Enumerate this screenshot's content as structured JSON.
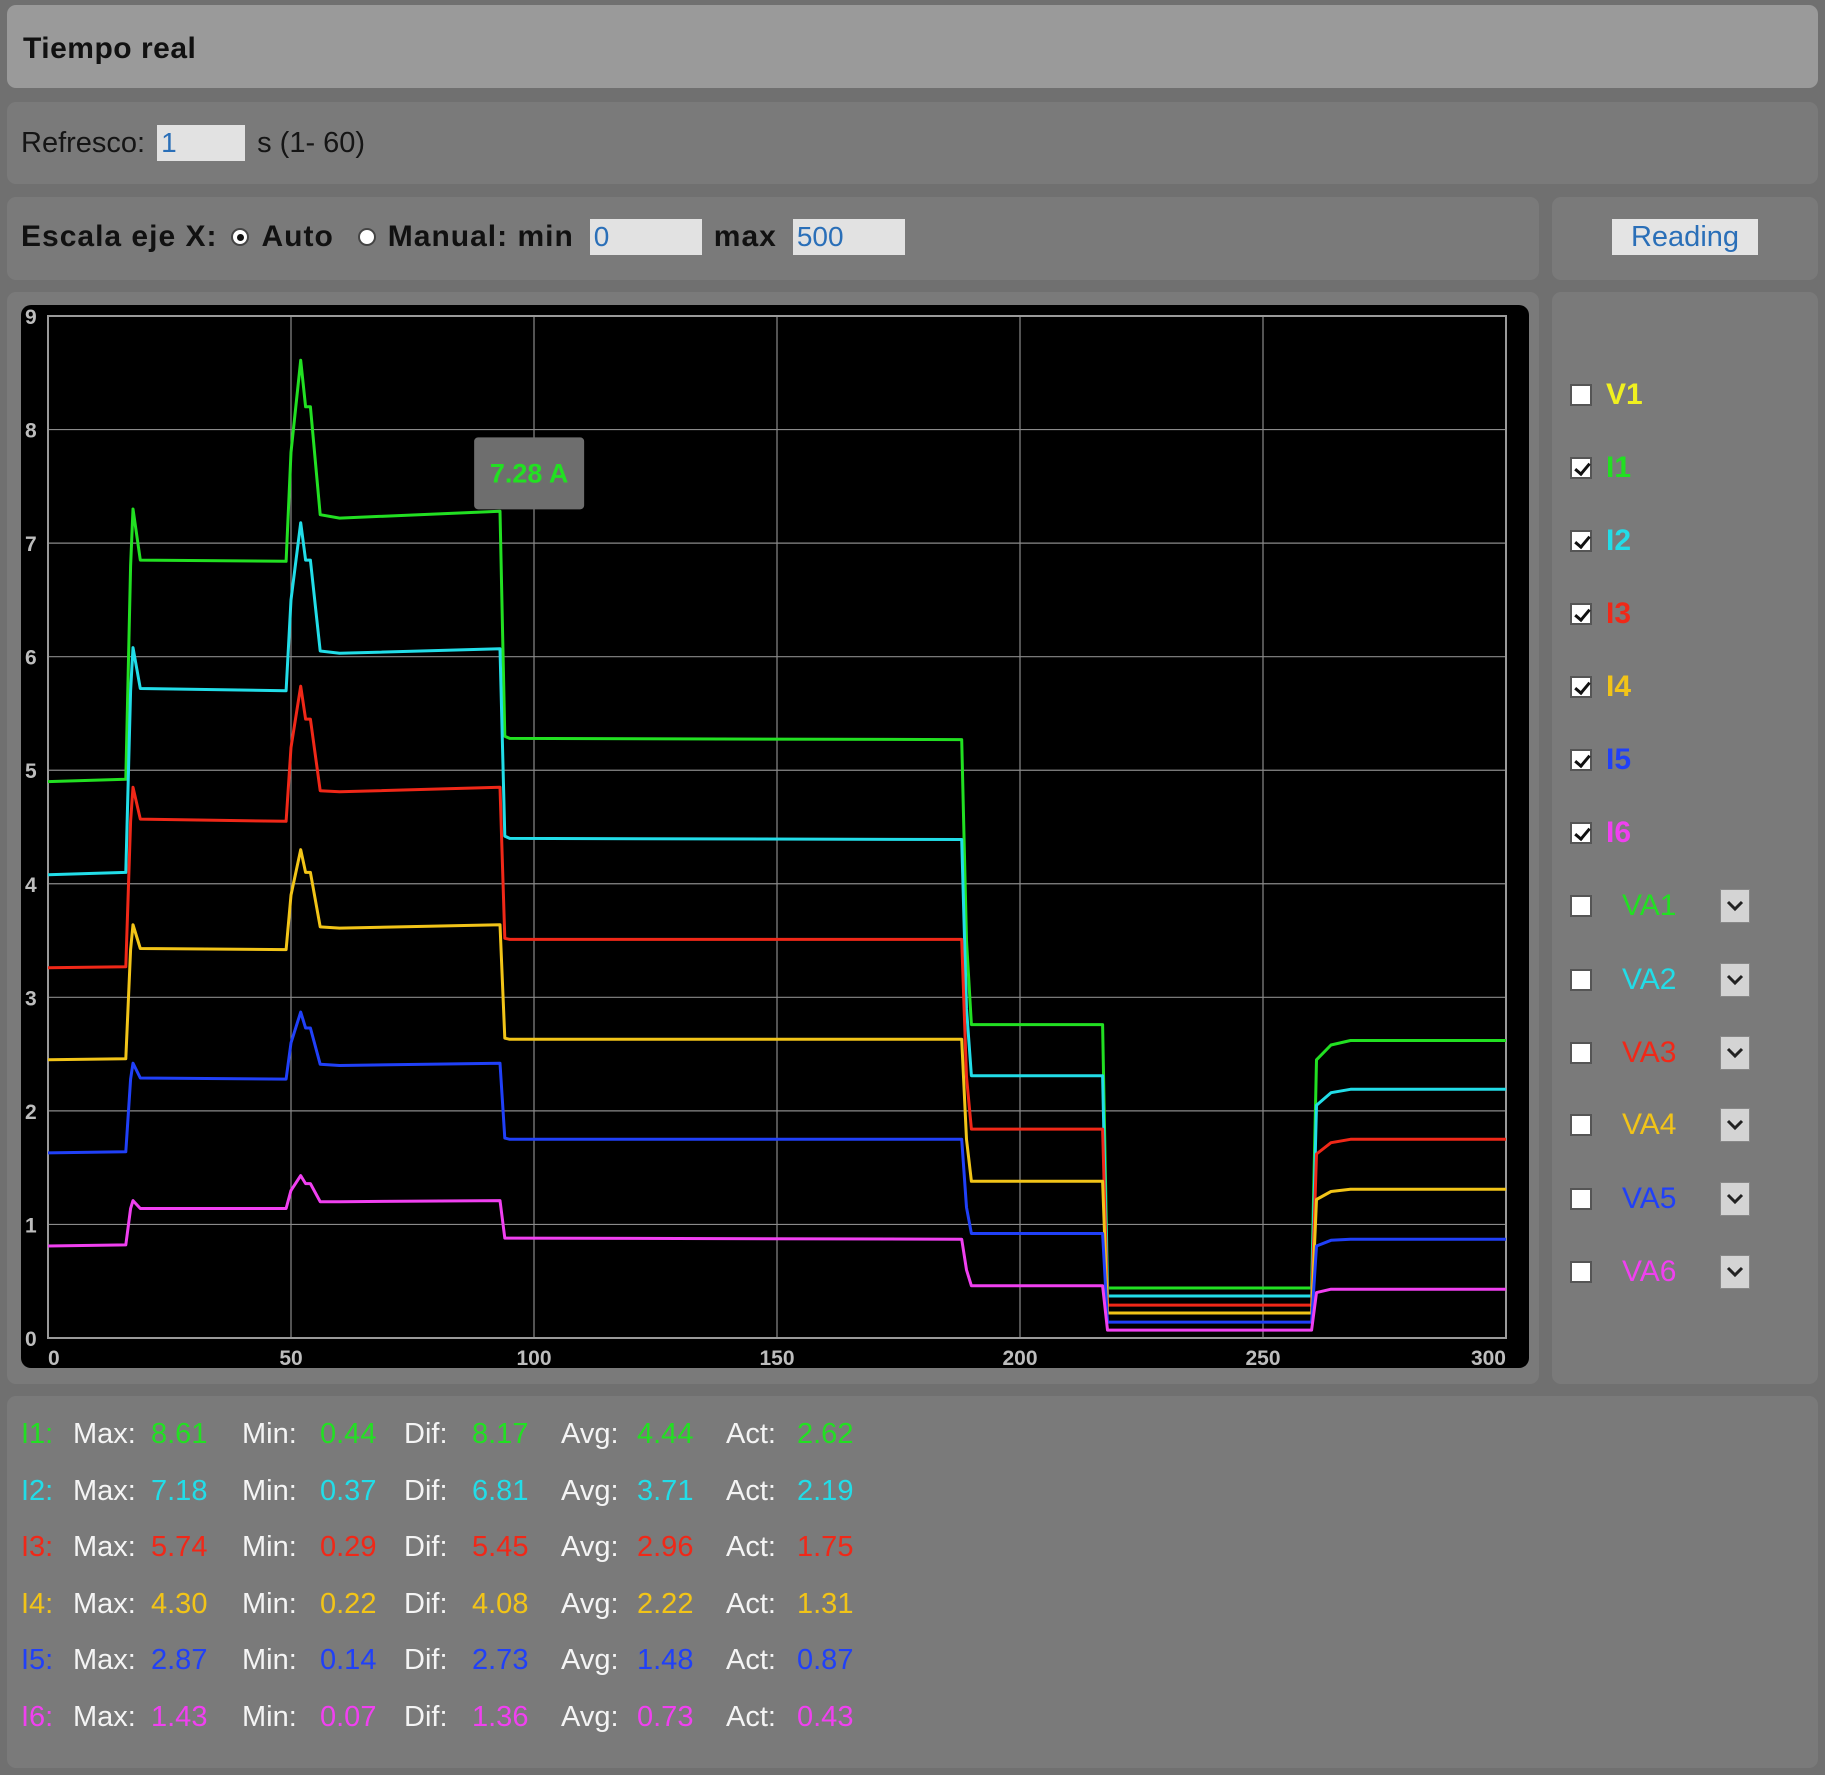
{
  "title": "Tiempo real",
  "refresh": {
    "label": "Refresco:",
    "value": "1",
    "suffix": "s (1- 60)"
  },
  "xscale": {
    "label": "Escala eje X:",
    "auto_label": "Auto",
    "manual_label": "Manual: min",
    "min_value": "0",
    "max_label": "max",
    "max_value": "500",
    "selected": "Auto"
  },
  "reading_button": "Reading",
  "colors": {
    "I1": "#22e022",
    "I2": "#22dde8",
    "I3": "#f02818",
    "I4": "#f2c418",
    "I5": "#2040f8",
    "I6": "#f040f0",
    "V1": "#f0f020",
    "background": "#707070",
    "plot_bg": "#000000"
  },
  "legend": [
    {
      "label": "V1",
      "checked": false,
      "color": "#f0f020",
      "dropdown": false
    },
    {
      "label": "I1",
      "checked": true,
      "color": "#22e022",
      "dropdown": false
    },
    {
      "label": "I2",
      "checked": true,
      "color": "#22dde8",
      "dropdown": false
    },
    {
      "label": "I3",
      "checked": true,
      "color": "#f02818",
      "dropdown": false
    },
    {
      "label": "I4",
      "checked": true,
      "color": "#f2c418",
      "dropdown": false
    },
    {
      "label": "I5",
      "checked": true,
      "color": "#2040f8",
      "dropdown": false
    },
    {
      "label": "I6",
      "checked": true,
      "color": "#f040f0",
      "dropdown": false
    },
    {
      "label": "VA1",
      "checked": false,
      "color": "#22e022",
      "dropdown": true
    },
    {
      "label": "VA2",
      "checked": false,
      "color": "#22dde8",
      "dropdown": true
    },
    {
      "label": "VA3",
      "checked": false,
      "color": "#f02818",
      "dropdown": true
    },
    {
      "label": "VA4",
      "checked": false,
      "color": "#f2c418",
      "dropdown": true
    },
    {
      "label": "VA5",
      "checked": false,
      "color": "#2040f8",
      "dropdown": true
    },
    {
      "label": "VA6",
      "checked": false,
      "color": "#f040f0",
      "dropdown": true
    }
  ],
  "tooltip": {
    "text": "7.28 A",
    "x": 99,
    "y": 7.28
  },
  "stats_labels": {
    "max": "Max:",
    "min": "Min:",
    "dif": "Dif:",
    "avg": "Avg:",
    "act": "Act:"
  },
  "stats": [
    {
      "name": "I1:",
      "color": "#22e022",
      "max": "8.61",
      "min": "0.44",
      "dif": "8.17",
      "avg": "4.44",
      "act": "2.62"
    },
    {
      "name": "I2:",
      "color": "#22dde8",
      "max": "7.18",
      "min": "0.37",
      "dif": "6.81",
      "avg": "3.71",
      "act": "2.19"
    },
    {
      "name": "I3:",
      "color": "#f02818",
      "max": "5.74",
      "min": "0.29",
      "dif": "5.45",
      "avg": "2.96",
      "act": "1.75"
    },
    {
      "name": "I4:",
      "color": "#f2c418",
      "max": "4.30",
      "min": "0.22",
      "dif": "4.08",
      "avg": "2.22",
      "act": "1.31"
    },
    {
      "name": "I5:",
      "color": "#2040f8",
      "max": "2.87",
      "min": "0.14",
      "dif": "2.73",
      "avg": "1.48",
      "act": "0.87"
    },
    {
      "name": "I6:",
      "color": "#f040f0",
      "max": "1.43",
      "min": "0.07",
      "dif": "1.36",
      "avg": "0.73",
      "act": "0.43"
    }
  ],
  "chart_data": {
    "type": "line",
    "xlim": [
      0,
      300
    ],
    "ylim": [
      0,
      9
    ],
    "xticks": [
      0,
      50,
      100,
      150,
      200,
      250,
      300
    ],
    "yticks": [
      0,
      1,
      2,
      3,
      4,
      5,
      6,
      7,
      8,
      9
    ],
    "grid": true,
    "series": [
      {
        "name": "I1",
        "color": "#22e022",
        "points": [
          [
            0,
            4.9
          ],
          [
            16,
            4.92
          ],
          [
            17,
            6.8
          ],
          [
            17.5,
            7.3
          ],
          [
            19,
            6.85
          ],
          [
            49,
            6.84
          ],
          [
            50,
            7.8
          ],
          [
            52,
            8.61
          ],
          [
            53,
            8.2
          ],
          [
            54,
            8.2
          ],
          [
            56,
            7.25
          ],
          [
            60,
            7.22
          ],
          [
            93,
            7.28
          ],
          [
            94,
            5.3
          ],
          [
            95,
            5.28
          ],
          [
            188,
            5.27
          ],
          [
            189,
            3.5
          ],
          [
            190,
            2.76
          ],
          [
            217,
            2.76
          ],
          [
            218,
            0.44
          ],
          [
            260,
            0.44
          ],
          [
            261,
            2.45
          ],
          [
            264,
            2.58
          ],
          [
            268,
            2.62
          ],
          [
            300,
            2.62
          ]
        ]
      },
      {
        "name": "I2",
        "color": "#22dde8",
        "points": [
          [
            0,
            4.08
          ],
          [
            16,
            4.1
          ],
          [
            17,
            5.7
          ],
          [
            17.5,
            6.08
          ],
          [
            19,
            5.72
          ],
          [
            49,
            5.7
          ],
          [
            50,
            6.5
          ],
          [
            52,
            7.18
          ],
          [
            53,
            6.85
          ],
          [
            54,
            6.85
          ],
          [
            56,
            6.05
          ],
          [
            60,
            6.03
          ],
          [
            93,
            6.07
          ],
          [
            94,
            4.42
          ],
          [
            95,
            4.4
          ],
          [
            188,
            4.39
          ],
          [
            189,
            2.9
          ],
          [
            190,
            2.31
          ],
          [
            217,
            2.31
          ],
          [
            218,
            0.37
          ],
          [
            260,
            0.37
          ],
          [
            261,
            2.05
          ],
          [
            264,
            2.16
          ],
          [
            268,
            2.19
          ],
          [
            300,
            2.19
          ]
        ]
      },
      {
        "name": "I3",
        "color": "#f02818",
        "points": [
          [
            0,
            3.26
          ],
          [
            16,
            3.27
          ],
          [
            17,
            4.55
          ],
          [
            17.5,
            4.85
          ],
          [
            19,
            4.57
          ],
          [
            49,
            4.55
          ],
          [
            50,
            5.2
          ],
          [
            52,
            5.74
          ],
          [
            53,
            5.45
          ],
          [
            54,
            5.45
          ],
          [
            56,
            4.82
          ],
          [
            60,
            4.81
          ],
          [
            93,
            4.85
          ],
          [
            94,
            3.52
          ],
          [
            95,
            3.51
          ],
          [
            188,
            3.51
          ],
          [
            189,
            2.3
          ],
          [
            190,
            1.84
          ],
          [
            217,
            1.84
          ],
          [
            218,
            0.29
          ],
          [
            260,
            0.29
          ],
          [
            261,
            1.62
          ],
          [
            264,
            1.72
          ],
          [
            268,
            1.75
          ],
          [
            300,
            1.75
          ]
        ]
      },
      {
        "name": "I4",
        "color": "#f2c418",
        "points": [
          [
            0,
            2.45
          ],
          [
            16,
            2.46
          ],
          [
            17,
            3.42
          ],
          [
            17.5,
            3.64
          ],
          [
            19,
            3.43
          ],
          [
            49,
            3.42
          ],
          [
            50,
            3.9
          ],
          [
            52,
            4.3
          ],
          [
            53,
            4.1
          ],
          [
            54,
            4.1
          ],
          [
            56,
            3.62
          ],
          [
            60,
            3.61
          ],
          [
            93,
            3.64
          ],
          [
            94,
            2.64
          ],
          [
            95,
            2.63
          ],
          [
            188,
            2.63
          ],
          [
            189,
            1.75
          ],
          [
            190,
            1.38
          ],
          [
            217,
            1.38
          ],
          [
            218,
            0.22
          ],
          [
            260,
            0.22
          ],
          [
            261,
            1.22
          ],
          [
            264,
            1.29
          ],
          [
            268,
            1.31
          ],
          [
            300,
            1.31
          ]
        ]
      },
      {
        "name": "I5",
        "color": "#2040f8",
        "points": [
          [
            0,
            1.63
          ],
          [
            16,
            1.64
          ],
          [
            17,
            2.28
          ],
          [
            17.5,
            2.42
          ],
          [
            19,
            2.29
          ],
          [
            49,
            2.28
          ],
          [
            50,
            2.6
          ],
          [
            52,
            2.87
          ],
          [
            53,
            2.73
          ],
          [
            54,
            2.73
          ],
          [
            56,
            2.41
          ],
          [
            60,
            2.4
          ],
          [
            93,
            2.42
          ],
          [
            94,
            1.76
          ],
          [
            95,
            1.75
          ],
          [
            188,
            1.75
          ],
          [
            189,
            1.15
          ],
          [
            190,
            0.92
          ],
          [
            217,
            0.92
          ],
          [
            218,
            0.14
          ],
          [
            260,
            0.14
          ],
          [
            261,
            0.81
          ],
          [
            264,
            0.86
          ],
          [
            268,
            0.87
          ],
          [
            300,
            0.87
          ]
        ]
      },
      {
        "name": "I6",
        "color": "#f040f0",
        "points": [
          [
            0,
            0.81
          ],
          [
            16,
            0.82
          ],
          [
            17,
            1.14
          ],
          [
            17.5,
            1.21
          ],
          [
            19,
            1.14
          ],
          [
            49,
            1.14
          ],
          [
            50,
            1.3
          ],
          [
            52,
            1.43
          ],
          [
            53,
            1.36
          ],
          [
            54,
            1.36
          ],
          [
            56,
            1.2
          ],
          [
            60,
            1.2
          ],
          [
            93,
            1.21
          ],
          [
            94,
            0.88
          ],
          [
            95,
            0.88
          ],
          [
            188,
            0.87
          ],
          [
            189,
            0.6
          ],
          [
            190,
            0.46
          ],
          [
            217,
            0.46
          ],
          [
            218,
            0.07
          ],
          [
            260,
            0.07
          ],
          [
            261,
            0.4
          ],
          [
            264,
            0.43
          ],
          [
            268,
            0.43
          ],
          [
            300,
            0.43
          ]
        ]
      }
    ]
  }
}
